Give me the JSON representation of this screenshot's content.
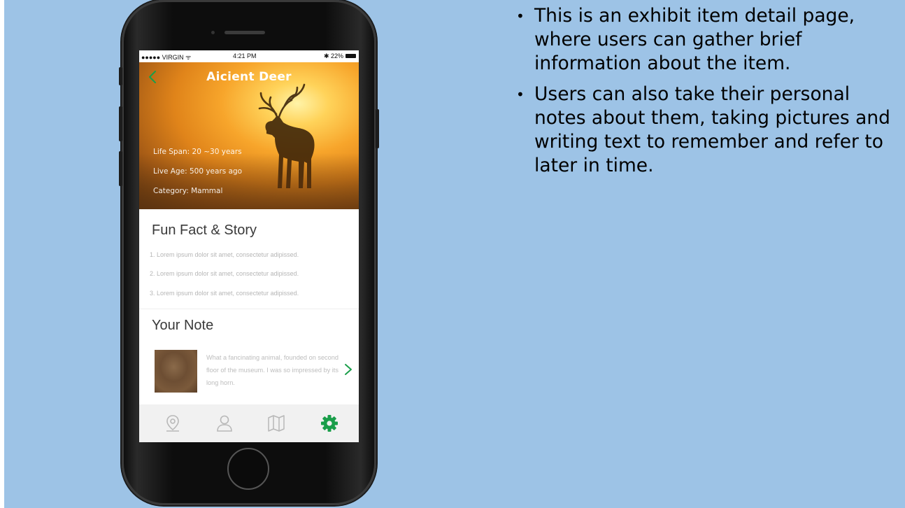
{
  "status_bar": {
    "carrier": "●●●●● VIRGIN ᯤ",
    "time": "4:21 PM",
    "battery": "✱ 22%"
  },
  "hero": {
    "title": "Aicient Deer",
    "info": [
      "Life Span: 20 ~30 years",
      "Live Age: 500 years ago",
      "Category: Mammal"
    ]
  },
  "fun_fact": {
    "title": "Fun Fact & Story",
    "items": [
      "1. Lorem ipsum dolor sit amet, consectetur adipissed.",
      "2. Lorem ipsum dolor sit amet, consectetur adipissed.",
      "3. Lorem ipsum dolor sit amet, consectetur adipissed."
    ]
  },
  "note": {
    "title": "Your Note",
    "text": "What a fancinating animal, founded on second floor of the museum. I was so impressed by its long horn."
  },
  "tab_bar": {
    "icons": [
      "location-pin-icon",
      "profile-icon",
      "map-icon",
      "settings-gear-icon"
    ],
    "active_color": "#1a9e4a",
    "inactive_color": "#b8b8b8"
  },
  "bullets": [
    "This is an exhibit item detail page, where users can gather brief information about the item.",
    "Users can also take their personal notes about them, taking pictures and writing text to remember and refer to later in time."
  ],
  "colors": {
    "background": "#9dc3e6",
    "accent_green": "#1a9e4a"
  }
}
